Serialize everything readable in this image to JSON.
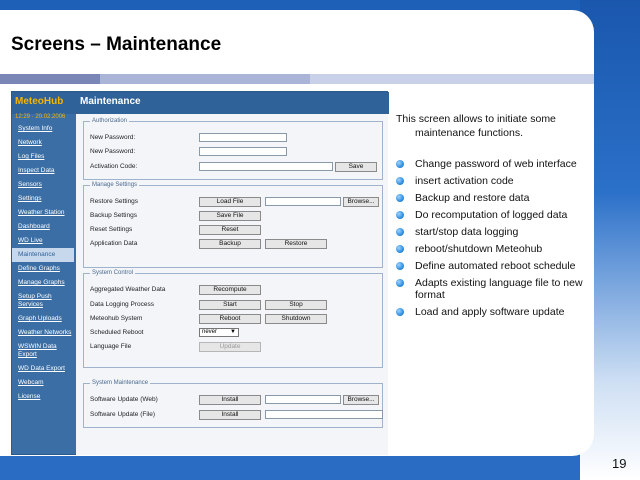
{
  "slide": {
    "title": "Screens – Maintenance",
    "intro_line1": "This screen allows to initiate some",
    "intro_line2": "maintenance functions.",
    "bullets": [
      "Change password of web interface",
      "insert activation code",
      "Backup and restore data",
      "Do recomputation of logged data",
      "start/stop data logging",
      "reboot/shutdown Meteohub",
      "Define automated reboot schedule",
      "Adapts existing language file to new format",
      "Load and apply software update"
    ],
    "page_number": "19"
  },
  "app": {
    "logo": "MeteoHub",
    "page_title": "Maintenance",
    "datetime": "12:29 · 20.02.2006",
    "nav": [
      "System Info",
      "Network",
      "Log Files",
      "Inspect Data",
      "Sensors",
      "Settings",
      "Weather Station",
      "Dashboard",
      "WD Live",
      "Maintenance",
      "Define Graphs",
      "Manage Graphs",
      "Setup Push Services",
      "Graph Uploads",
      "Weather Networks",
      "WSWIN Data Export",
      "WD Data Export",
      "Webcam",
      "License"
    ],
    "active_nav": "Maintenance",
    "authorization": {
      "legend": "Authorization",
      "new_password_label": "New Password:",
      "new_password2_label": "New Password:",
      "activation_label": "Activation Code:",
      "save_label": "Save"
    },
    "manage_settings": {
      "legend": "Manage Settings",
      "restore_label": "Restore Settings",
      "load_file_label": "Load File",
      "browse_label": "Browse...",
      "backup_label": "Backup Settings",
      "save_file_label": "Save File",
      "reset_label": "Reset Settings",
      "reset_button": "Reset",
      "appdata_label": "Application Data",
      "backup_button": "Backup",
      "restore_button": "Restore"
    },
    "system_control": {
      "legend": "System Control",
      "aggregated_label": "Aggregated Weather Data",
      "recompute_button": "Recompute",
      "logging_label": "Data Logging Process",
      "start_button": "Start",
      "stop_button": "Stop",
      "meteohub_label": "Meteohub System",
      "reboot_button": "Reboot",
      "shutdown_button": "Shutdown",
      "scheduled_label": "Scheduled Reboot",
      "scheduled_value": "never",
      "language_label": "Language File",
      "update_button": "Update"
    },
    "system_maintenance": {
      "legend": "System Maintenance",
      "web_label": "Software Update (Web)",
      "file_label": "Software Update (File)",
      "install_button": "Install",
      "install_button2": "Install",
      "browse_label": "Browse..."
    }
  }
}
